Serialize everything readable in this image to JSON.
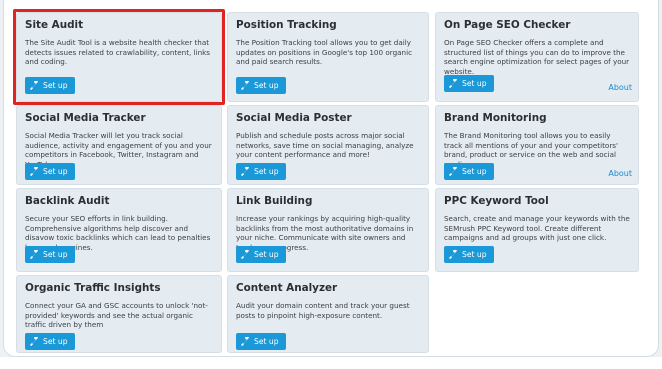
{
  "tools": [
    {
      "title": "Site Audit",
      "desc": "The Site Audit Tool is a website health checker that detects issues related to crawlability, content, links and coding.",
      "button": "Set up",
      "about": ""
    },
    {
      "title": "Position Tracking",
      "desc": "The Position Tracking tool allows you to get daily updates on positions in Google's top 100 organic and paid search results.",
      "button": "Set up",
      "about": ""
    },
    {
      "title": "On Page SEO Checker",
      "desc": "On Page SEO Checker offers a complete and structured list of things you can do to improve the search engine optimization for select pages of your website.",
      "button": "Set up",
      "about": "About"
    },
    {
      "title": "Social Media Tracker",
      "desc": "Social Media Tracker will let you track social audience, activity and engagement of you and your competitors in Facebook, Twitter, Instagram and YouTube.",
      "button": "Set up",
      "about": ""
    },
    {
      "title": "Social Media Poster",
      "desc": "Publish and schedule posts across major social networks, save time on social managing, analyze your content performance and more!",
      "button": "Set up",
      "about": ""
    },
    {
      "title": "Brand Monitoring",
      "desc": "The Brand Monitoring tool allows you to easily track all mentions of your and your competitors' brand, product or service on the web and social media.",
      "button": "Set up",
      "about": "About"
    },
    {
      "title": "Backlink Audit",
      "desc": "Secure your SEO efforts in link building. Comprehensive algorithms help discover and disavow toxic backlinks which can lead to penalties by search engines.",
      "button": "Set up",
      "about": ""
    },
    {
      "title": "Link Building",
      "desc": "Increase your rankings by acquiring high-quality backlinks from the most authoritative domains in your niche. Communicate with site owners and track your progress.",
      "button": "Set up",
      "about": ""
    },
    {
      "title": "PPC Keyword Tool",
      "desc": "Search, create and manage your keywords with the SEMrush PPC Keyword tool. Create different campaigns and ad groups with just one click.",
      "button": "Set up",
      "about": ""
    },
    {
      "title": "Organic Traffic Insights",
      "desc": "Connect your GA and GSC accounts to unlock 'not-provided' keywords and see the actual organic traffic driven by them",
      "button": "Set up",
      "about": ""
    },
    {
      "title": "Content Analyzer",
      "desc": "Audit your domain content and track your guest posts to pinpoint high-exposure content.",
      "button": "Set up",
      "about": ""
    }
  ],
  "colors": {
    "button": "#1a98d7",
    "card": "#e4ebf1",
    "highlight": "#e02424",
    "link": "#1a8ad0"
  },
  "icons": {
    "setup": "wrench-icon"
  }
}
